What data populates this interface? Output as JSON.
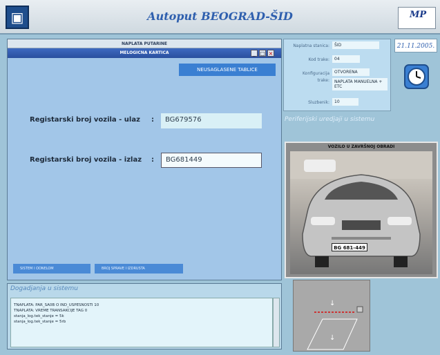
{
  "header": {
    "title": "Autoput BEOGRAD-ŠID",
    "mp_logo_text": "MP"
  },
  "main_window": {
    "outer_title": "NAPLATA PUTARINE",
    "inner_title": "MELOGICNA KARTICA",
    "button_neusaglasene": "NEUSAGLASENE TABLICE",
    "entry": {
      "label": "Registarski broj vozila - ulaz",
      "colon": ":",
      "value": "BG679576"
    },
    "exit": {
      "label": "Registarski broj vozila - izlaz",
      "colon": ":",
      "value": "BG681449"
    },
    "bottom_left_button": "SISTEM I ODNELOM",
    "bottom_mid_button": "BROJ SPRAVE I IZDRUSTA"
  },
  "events": {
    "title": "Dogadjanja u sistemu",
    "lines": [
      "TNAPLATA: PAR_SA0B O IND_USPESNOSTI 10",
      "TNAPLATA: VREME TRANSAKCIJE TAG 0",
      "stanja_log.tek_stanje = 5k",
      "stanja_log.tek_stanje = 5rb"
    ]
  },
  "station": {
    "rows": [
      {
        "label": "Naplatna stanica:",
        "value": "ŠID"
      },
      {
        "label": "Kod trake:",
        "value": "04"
      },
      {
        "label": "Konfiguracija",
        "value": "OTVORENA"
      },
      {
        "label": "trake:",
        "value": "NAPLATA MANUELNA + ETC"
      },
      {
        "label": "Sluzbenik:",
        "value": "10"
      }
    ]
  },
  "date": "21.11.2005.",
  "peripherals_title": "Periferijski uredjaji u sistemu",
  "camera": {
    "title": "VOZILO U ZAVRŠNOJ OBRADI",
    "plate": "BG 681-449"
  },
  "colors": {
    "accent": "#3a7fd2",
    "title_blue": "#2e5fae"
  }
}
